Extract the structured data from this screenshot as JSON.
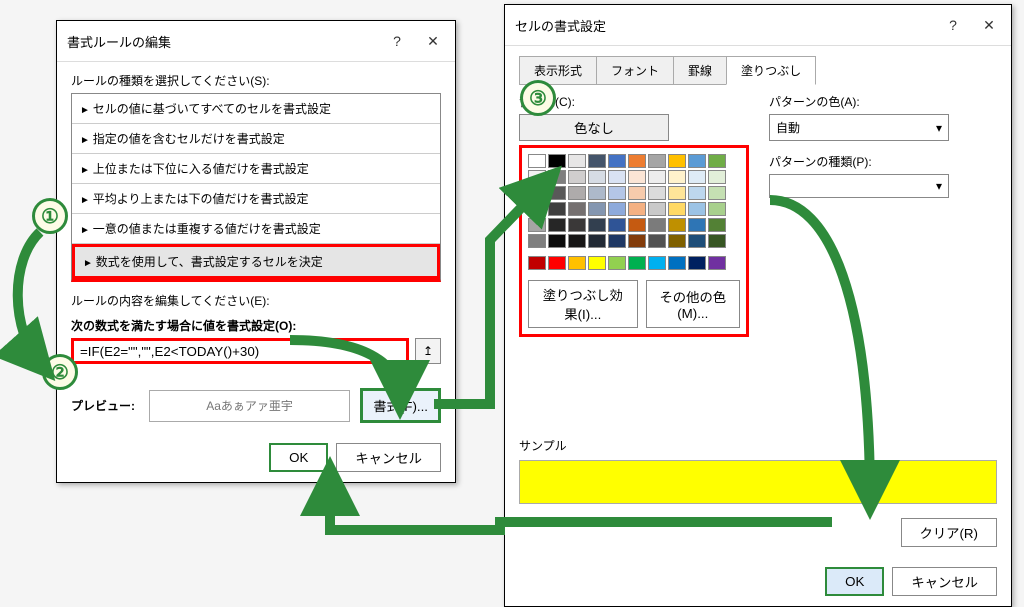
{
  "left_dialog": {
    "title": "書式ルールの編集",
    "select_rule_type_label": "ルールの種類を選択してください(S):",
    "rule_types": [
      "セルの値に基づいてすべてのセルを書式設定",
      "指定の値を含むセルだけを書式設定",
      "上位または下位に入る値だけを書式設定",
      "平均より上または下の値だけを書式設定",
      "一意の値または重複する値だけを書式設定",
      "数式を使用して、書式設定するセルを決定"
    ],
    "edit_rule_label": "ルールの内容を編集してください(E):",
    "formula_label": "次の数式を満たす場合に値を書式設定(O):",
    "formula_value": "=IF(E2=\"\",\"\",E2<TODAY()+30)",
    "preview_label": "プレビュー:",
    "preview_text": "Aaあぁアァ亜宇",
    "format_btn": "書式(F)...",
    "ok": "OK",
    "cancel": "キャンセル"
  },
  "right_dialog": {
    "title": "セルの書式設定",
    "tabs": [
      "表示形式",
      "フォント",
      "罫線",
      "塗りつぶし"
    ],
    "bgcolor_label": "背景色(C):",
    "nocolor": "色なし",
    "fill_effects": "塗りつぶし効果(I)...",
    "other_colors": "その他の色(M)...",
    "pattern_color_label": "パターンの色(A):",
    "pattern_color_value": "自動",
    "pattern_type_label": "パターンの種類(P):",
    "sample_label": "サンプル",
    "clear": "クリア(R)",
    "ok": "OK",
    "cancel": "キャンセル"
  },
  "badges": [
    "①",
    "②",
    "③"
  ],
  "palette": {
    "rows": [
      [
        "#fff",
        "#000",
        "#e7e6e6",
        "#44546a",
        "#4472c4",
        "#ed7d31",
        "#a5a5a5",
        "#ffc000",
        "#5b9bd5",
        "#70ad47"
      ],
      [
        "#f2f2f2",
        "#7f7f7f",
        "#d0cece",
        "#d6dce4",
        "#d9e2f3",
        "#fbe5d5",
        "#ededed",
        "#fff2cc",
        "#deebf6",
        "#e2efd9"
      ],
      [
        "#d8d8d8",
        "#595959",
        "#aeabab",
        "#adb9ca",
        "#b4c6e7",
        "#f7cbac",
        "#dbdbdb",
        "#fee599",
        "#bdd7ee",
        "#c5e0b3"
      ],
      [
        "#bfbfbf",
        "#3f3f3f",
        "#757070",
        "#8496b0",
        "#8eaadb",
        "#f4b183",
        "#c9c9c9",
        "#ffd965",
        "#9cc3e5",
        "#a8d08d"
      ],
      [
        "#a5a5a5",
        "#262626",
        "#3a3838",
        "#323f4f",
        "#2f5496",
        "#c55a11",
        "#7b7b7b",
        "#bf9000",
        "#2e75b5",
        "#538135"
      ],
      [
        "#7f7f7f",
        "#0c0c0c",
        "#171616",
        "#222a35",
        "#1f3864",
        "#833c0b",
        "#525252",
        "#7f6000",
        "#1e4e79",
        "#375623"
      ]
    ],
    "std": [
      "#c00000",
      "#ff0000",
      "#ffc000",
      "#ffff00",
      "#92d050",
      "#00b050",
      "#00b0f0",
      "#0070c0",
      "#002060",
      "#7030a0"
    ]
  }
}
